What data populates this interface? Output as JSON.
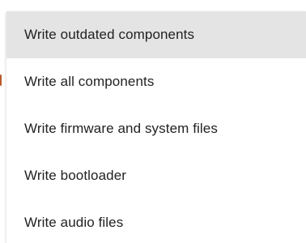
{
  "menu": {
    "items": [
      {
        "label": "Write outdated components",
        "selected": true
      },
      {
        "label": "Write all components",
        "selected": false
      },
      {
        "label": "Write firmware and system files",
        "selected": false
      },
      {
        "label": "Write bootloader",
        "selected": false
      },
      {
        "label": "Write audio files",
        "selected": false
      }
    ]
  },
  "colors": {
    "selected_background": "#e4e4e4",
    "text": "#222222",
    "accent": "#b85a2a"
  }
}
